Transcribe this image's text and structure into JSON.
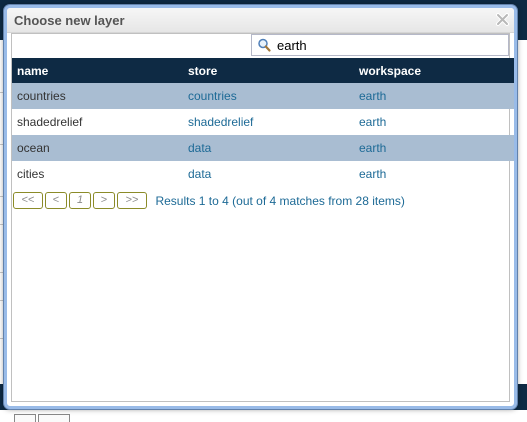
{
  "dialog": {
    "title": "Choose new layer",
    "close_icon": "close-x-icon"
  },
  "search": {
    "icon": "search-icon",
    "value": "earth",
    "placeholder": ""
  },
  "table": {
    "columns": [
      "name",
      "store",
      "workspace"
    ],
    "rows": [
      {
        "name": "countries",
        "store": "countries",
        "workspace": "earth"
      },
      {
        "name": "shadedrelief",
        "store": "shadedrelief",
        "workspace": "earth"
      },
      {
        "name": "ocean",
        "store": "data",
        "workspace": "earth"
      },
      {
        "name": "cities",
        "store": "data",
        "workspace": "earth"
      }
    ]
  },
  "pager": {
    "first": "<<",
    "prev": "<",
    "page": "1",
    "next": ">",
    "last": ">>",
    "results": "Results 1 to 4 (out of 4 matches from 28 items)"
  },
  "colors": {
    "header_bg": "#0e2a44",
    "row_highlight": "#a9bdd2",
    "link": "#1d6a96",
    "dialog_border": "#99bbe8"
  }
}
